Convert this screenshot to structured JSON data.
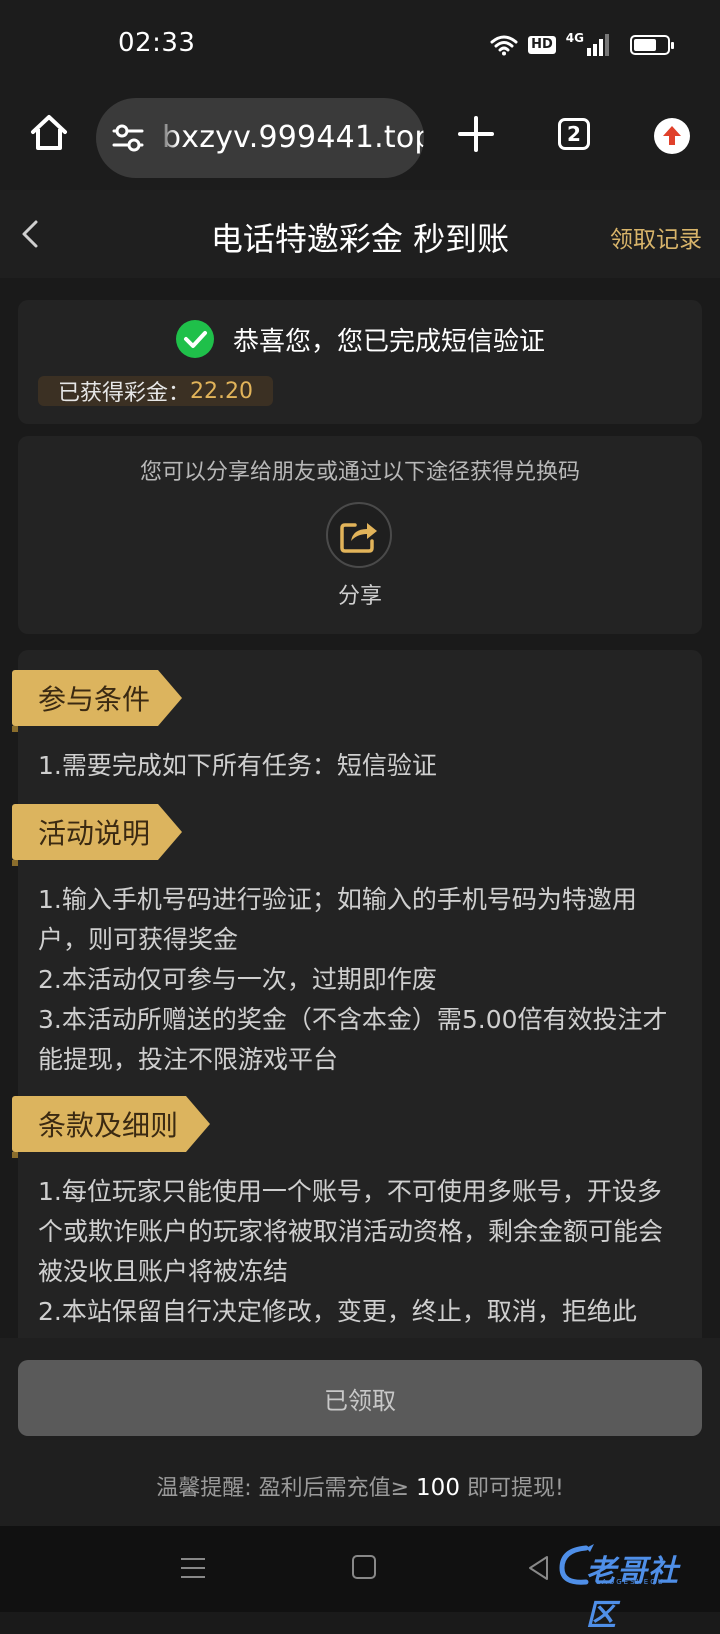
{
  "status_bar": {
    "time": "02:33",
    "hd_label": "HD",
    "network_label": "4G",
    "battery_level": 0.7
  },
  "browser": {
    "url": "bxzyv.999441.top",
    "tab_count": "2"
  },
  "header": {
    "title": "电话特邀彩金 秒到账",
    "records_link": "领取记录"
  },
  "verified_card": {
    "message": "恭喜您，您已完成短信验证",
    "bonus_label": "已获得彩金：",
    "bonus_value": "22.20"
  },
  "share_card": {
    "hint": "您可以分享给朋友或通过以下途径获得兑换码",
    "share_label": "分享"
  },
  "sections": {
    "conditions": {
      "title": "参与条件",
      "lines": [
        "1.需要完成如下所有任务：短信验证"
      ]
    },
    "description": {
      "title": "活动说明",
      "lines": [
        "1.输入手机号码进行验证；如输入的手机号码为特邀用户，则可获得奖金",
        "2.本活动仅可参与一次，过期即作废",
        "3.本活动所赠送的奖金（不含本金）需5.00倍有效投注才能提现，投注不限游戏平台"
      ]
    },
    "terms": {
      "title": "条款及细则",
      "lines": [
        "1.每位玩家只能使用一个账号，不可使用多账号，开设多个或欺诈账户的玩家将被取消活动资格，剩余金额可能会被没收且账户将被冻结",
        "2.本站保留自行决定修改，变更，终止，取消，拒绝此"
      ]
    }
  },
  "bottom": {
    "claimed_button": "已领取",
    "reminder_prefix": "温馨提醒: 盈利后需充值≥ ",
    "reminder_amount": "100",
    "reminder_suffix": " 即可提现!"
  },
  "watermark": {
    "text": "老哥社区",
    "sub": "LAOGESHEQU"
  },
  "colors": {
    "accent_gold": "#dcb45e",
    "bonus_gold": "#e2b45a",
    "success_green": "#1fc04a",
    "background": "#1a1a1a",
    "card": "#232323"
  },
  "icons": {
    "home": "home-icon",
    "settings": "tune-icon",
    "plus": "plus-icon",
    "share": "share-icon",
    "check": "check-circle-icon",
    "back": "chevron-left-icon"
  }
}
